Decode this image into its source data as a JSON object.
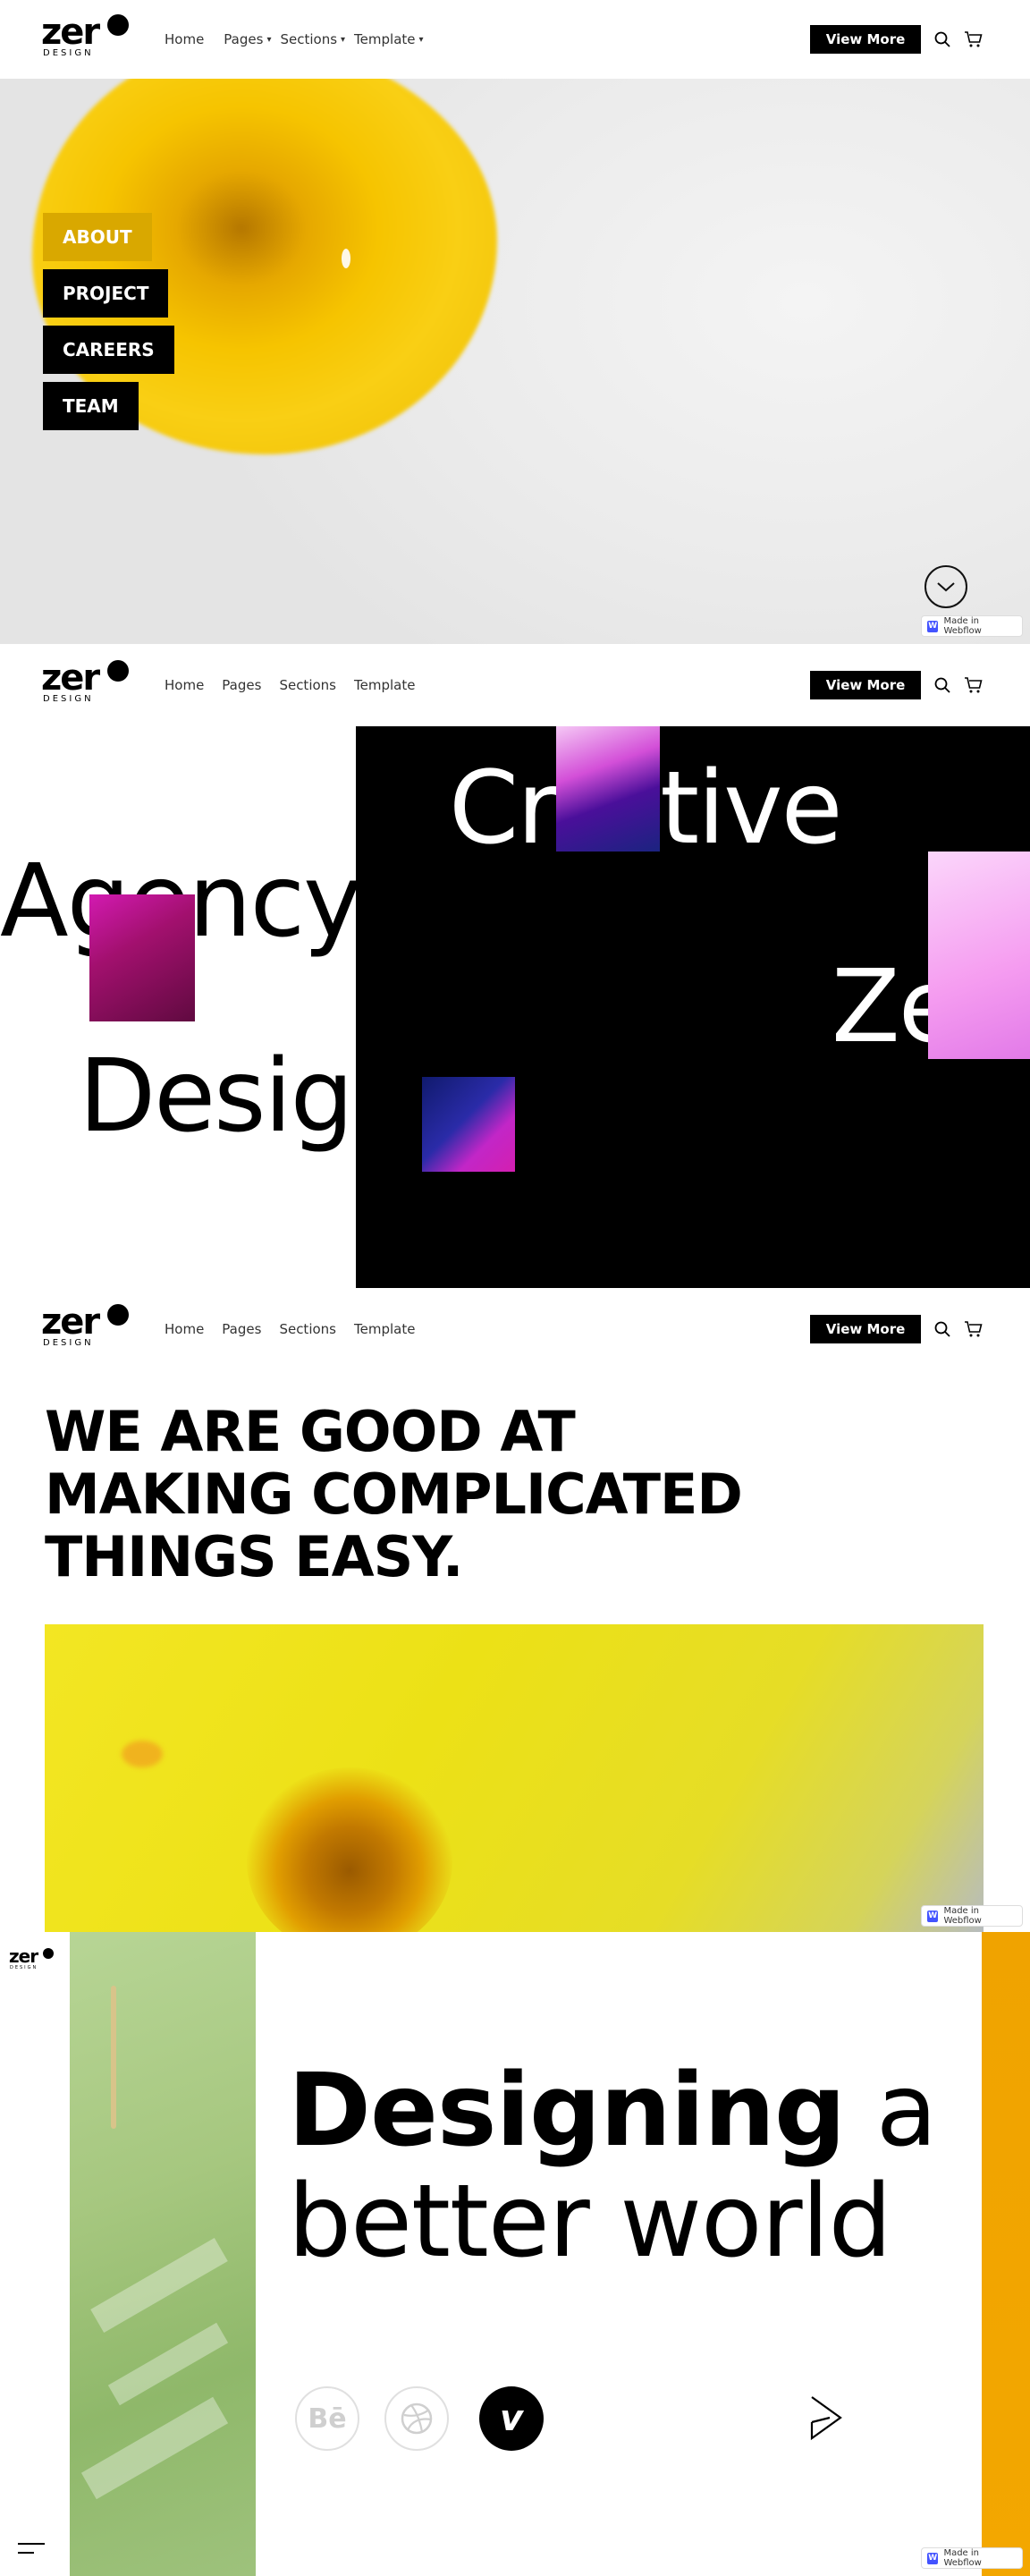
{
  "nav": {
    "logo_word": "zer",
    "logo_sub": "DESIGN",
    "home": "Home",
    "pages": "Pages",
    "sections": "Sections",
    "template": "Template",
    "view_more": "View More"
  },
  "section1": {
    "menu": [
      "ABOUT",
      "PROJECT",
      "CAREERS",
      "TEAM"
    ],
    "active_item": "ABOUT",
    "scroll_icon": "chevron-down-icon"
  },
  "section2": {
    "words": [
      "Cr",
      "tive",
      "Agency",
      "Ze",
      "Design"
    ]
  },
  "section3": {
    "headline_lines": [
      "WE ARE GOOD AT",
      "MAKING COMPLICATED",
      "THINGS EASY."
    ]
  },
  "section4": {
    "logo_word": "zer",
    "logo_sub": "DESIGN",
    "title_bold": "Designing",
    "title_rest_1": " a",
    "title_line_2": "better world",
    "socials": [
      "behance-icon",
      "dribbble-icon",
      "vimeo-icon"
    ],
    "behance_glyph": "Bē",
    "vimeo_glyph": "v"
  },
  "badge": {
    "text": "Made in Webflow",
    "icon_glyph": "W"
  },
  "colors": {
    "accent_yellow": "#d9a800",
    "orange": "#f0a300",
    "black": "#000000"
  }
}
